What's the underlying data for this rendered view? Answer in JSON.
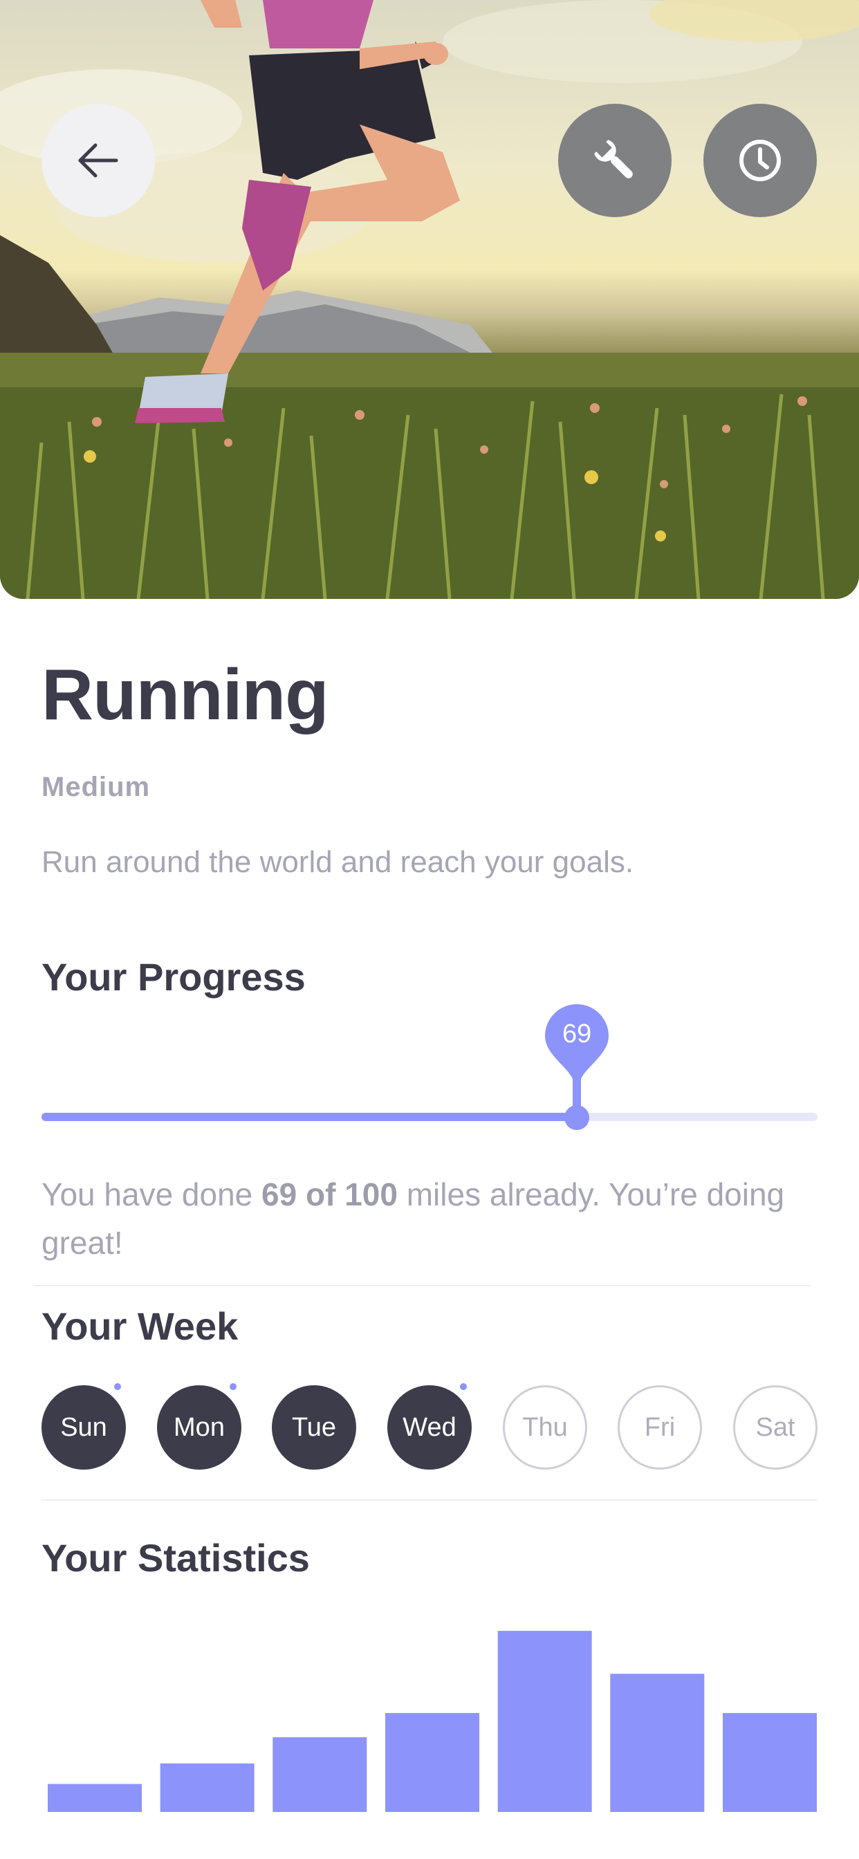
{
  "header": {
    "back_icon": "arrow-left-icon",
    "tool_icon": "wrench-icon",
    "clock_icon": "clock-icon",
    "image": "runner-in-meadow-photo"
  },
  "activity": {
    "title": "Running",
    "level": "Medium",
    "description": "Run around the world and reach your goals."
  },
  "progress": {
    "title": "Your Progress",
    "value": 69,
    "value_label": "69",
    "max": 100,
    "text_prefix": "You have done ",
    "text_bold": "69 of 100",
    "text_suffix": " miles already. You’re doing great!"
  },
  "week": {
    "title": "Your Week",
    "days": [
      {
        "label": "Sun",
        "done": true,
        "dot": true
      },
      {
        "label": "Mon",
        "done": true,
        "dot": true
      },
      {
        "label": "Tue",
        "done": true,
        "dot": false
      },
      {
        "label": "Wed",
        "done": true,
        "dot": true
      },
      {
        "label": "Thu",
        "done": false,
        "dot": false
      },
      {
        "label": "Fri",
        "done": false,
        "dot": false
      },
      {
        "label": "Sat",
        "done": false,
        "dot": false
      }
    ]
  },
  "statistics": {
    "title": "Your Statistics"
  },
  "colors": {
    "accent": "#8c93fb",
    "dark": "#3d3c4b",
    "muted": "#a6a5b5"
  },
  "chart_data": {
    "type": "bar",
    "categories": [
      "",
      "",
      "",
      "",
      "",
      "",
      ""
    ],
    "values": [
      15,
      26,
      40,
      53,
      97,
      74,
      53
    ],
    "ylim": [
      0,
      100
    ],
    "grid": false
  }
}
